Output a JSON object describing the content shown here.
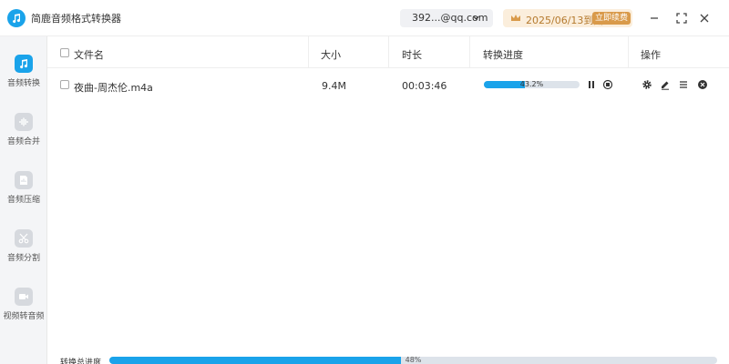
{
  "app": {
    "title": "简鹿音频格式转换器",
    "logo_icon": "music-note-icon"
  },
  "header": {
    "account": "392...@qq.com",
    "vip_expiry": "2025/06/13到期",
    "renew_label": "立即续费"
  },
  "sidebar": {
    "items": [
      {
        "label": "音频转换",
        "icon": "music-note-icon",
        "active": true
      },
      {
        "label": "音频合并",
        "icon": "waveform-icon",
        "active": false
      },
      {
        "label": "音频压缩",
        "icon": "compress-icon",
        "active": false
      },
      {
        "label": "音频分割",
        "icon": "scissors-icon",
        "active": false
      },
      {
        "label": "视频转音频",
        "icon": "video-icon",
        "active": false
      }
    ]
  },
  "table": {
    "columns": [
      "文件名",
      "大小",
      "时长",
      "转换进度",
      "操作"
    ],
    "rows": [
      {
        "name": "夜曲-周杰伦.m4a",
        "size": "9.4M",
        "duration": "00:03:46",
        "progress": 0.432,
        "progress_label": "43.2%"
      }
    ]
  },
  "total": {
    "label": "转换总进度",
    "progress": 0.48,
    "progress_label": "48%"
  },
  "colors": {
    "accent": "#1aa3ea",
    "vip_bg": "#fbeedc",
    "vip_text": "#b57a2e",
    "renew_bg": "#d99a4a"
  }
}
